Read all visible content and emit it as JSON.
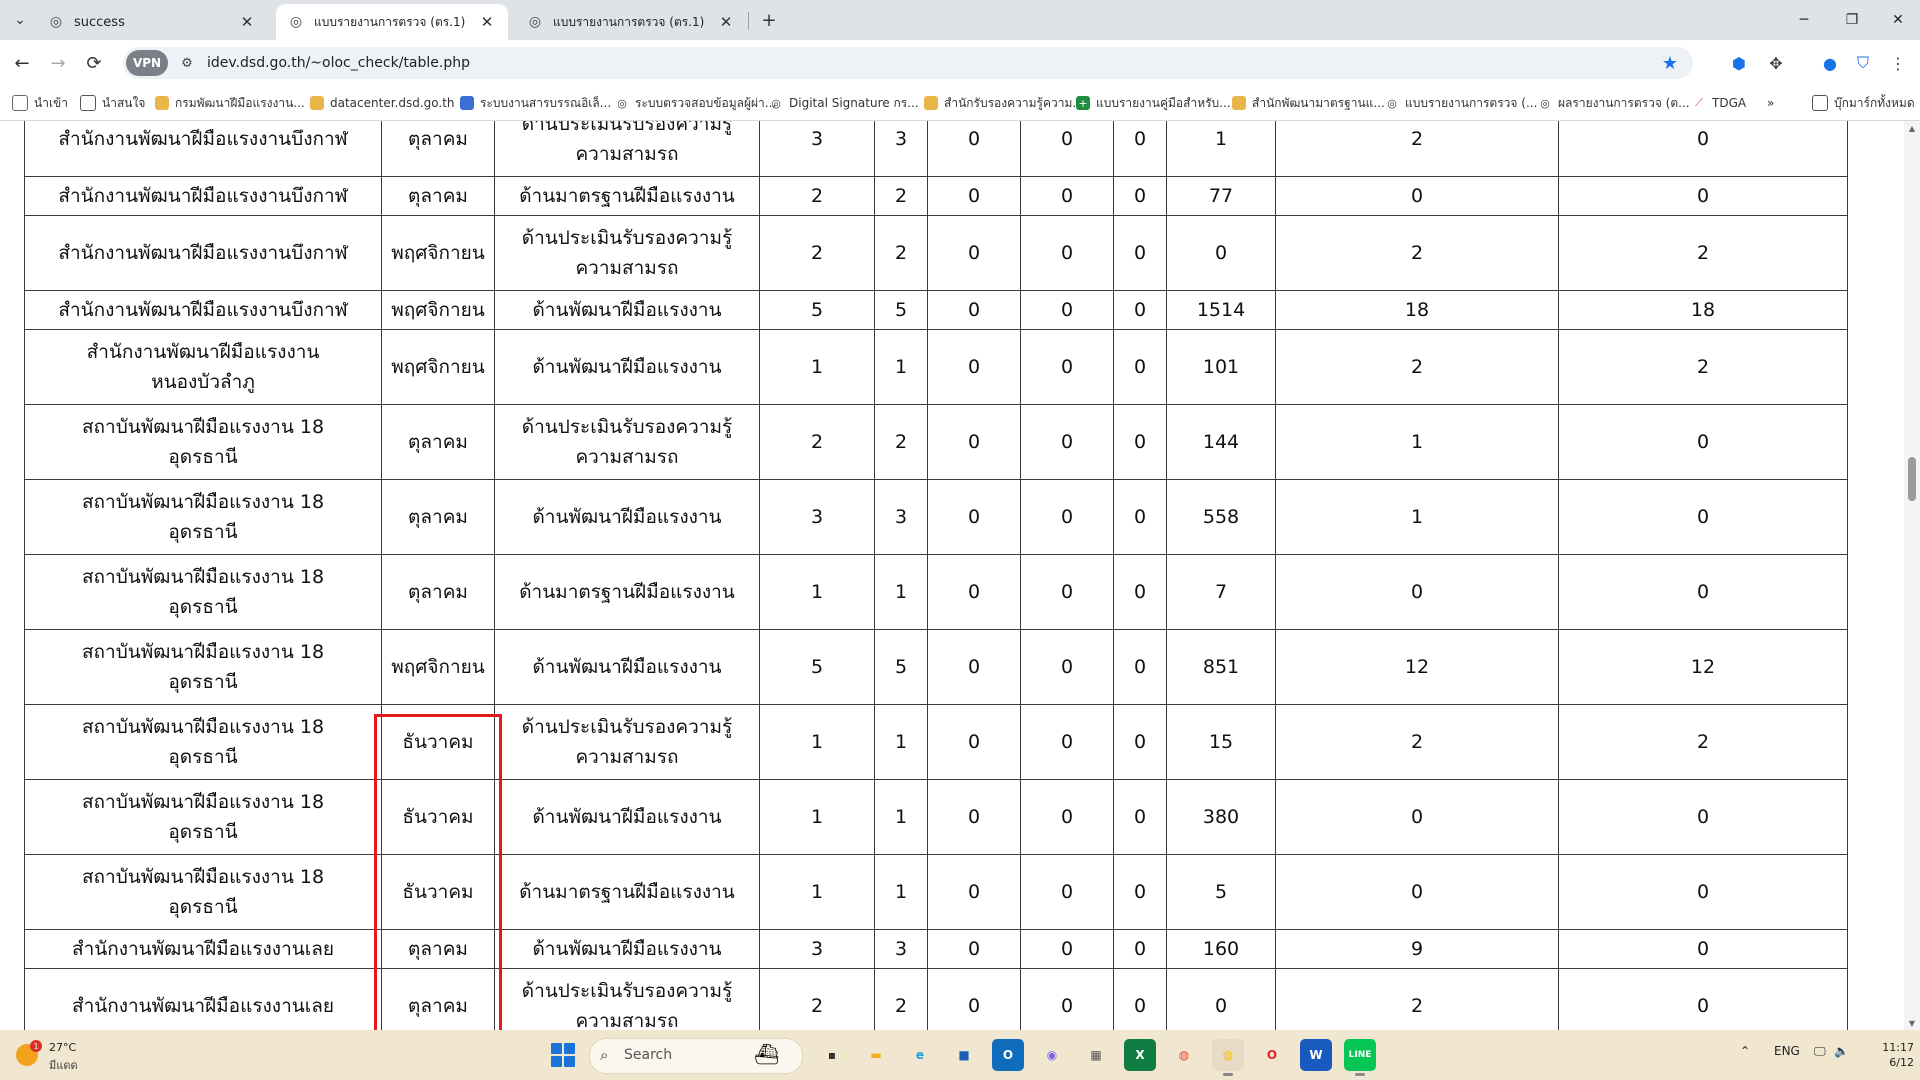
{
  "browser": {
    "tabs": [
      {
        "title": "success",
        "active": false
      },
      {
        "title": "แบบรายงานการตรวจ (ตร.1)",
        "active": true
      },
      {
        "title": "แบบรายงานการตรวจ (ตร.1)",
        "active": false
      }
    ],
    "vpn_label": "VPN",
    "url": "idev.dsd.go.th/~oloc_check/table.php"
  },
  "bookmarks": [
    {
      "label": "นำเข้า",
      "icon": "file-icon"
    },
    {
      "label": "นำสนใจ",
      "icon": "folder-icon"
    },
    {
      "label": "กรมพัฒนาฝีมือแรงงาน...",
      "icon": "dsd-icon"
    },
    {
      "label": "datacenter.dsd.go.th",
      "icon": "dsd-icon"
    },
    {
      "label": "ระบบงานสารบรรณอิเล็...",
      "icon": "doc-icon"
    },
    {
      "label": "ระบบตรวจสอบข้อมูลผู้ผ่า...",
      "icon": "globe-icon"
    },
    {
      "label": "Digital Signature กร...",
      "icon": "globe-icon"
    },
    {
      "label": "สำนักรับรองความรู้ความ...",
      "icon": "dsd-icon"
    },
    {
      "label": "แบบรายงานคู่มือสำหรับ...",
      "icon": "sheet-icon"
    },
    {
      "label": "สำนักพัฒนามาตรฐานแ...",
      "icon": "dsd-icon"
    },
    {
      "label": "แบบรายงานการตรวจ (...",
      "icon": "globe-icon"
    },
    {
      "label": "ผลรายงานการตรวจ (ต...",
      "icon": "globe-icon"
    },
    {
      "label": "TDGA",
      "icon": "tdga-icon"
    },
    {
      "label": "บุ๊กมาร์กทั้งหมด",
      "icon": "folder-icon"
    }
  ],
  "table": {
    "rows": [
      {
        "unit": [
          "สำนักงานพัฒนาฝีมือแรงงานบึงกาฬ"
        ],
        "month": "ตุลาคม",
        "category": [
          "ด้านประเมินรับรองความรู้",
          "ความสามรถ"
        ],
        "values": [
          "3",
          "3",
          "0",
          "0",
          "0",
          "1",
          "2",
          "0"
        ]
      },
      {
        "unit": [
          "สำนักงานพัฒนาฝีมือแรงงานบึงกาฬ"
        ],
        "month": "ตุลาคม",
        "category": [
          "ด้านมาตรฐานฝีมือแรงงาน"
        ],
        "values": [
          "2",
          "2",
          "0",
          "0",
          "0",
          "77",
          "0",
          "0"
        ]
      },
      {
        "unit": [
          "สำนักงานพัฒนาฝีมือแรงงานบึงกาฬ"
        ],
        "month": "พฤศจิกายน",
        "category": [
          "ด้านประเมินรับรองความรู้",
          "ความสามรถ"
        ],
        "values": [
          "2",
          "2",
          "0",
          "0",
          "0",
          "0",
          "2",
          "2"
        ]
      },
      {
        "unit": [
          "สำนักงานพัฒนาฝีมือแรงงานบึงกาฬ"
        ],
        "month": "พฤศจิกายน",
        "category": [
          "ด้านพัฒนาฝีมือแรงงาน"
        ],
        "values": [
          "5",
          "5",
          "0",
          "0",
          "0",
          "1514",
          "18",
          "18"
        ]
      },
      {
        "unit": [
          "สำนักงานพัฒนาฝีมือแรงงาน",
          "หนองบัวลำภู"
        ],
        "month": "พฤศจิกายน",
        "category": [
          "ด้านพัฒนาฝีมือแรงงาน"
        ],
        "values": [
          "1",
          "1",
          "0",
          "0",
          "0",
          "101",
          "2",
          "2"
        ]
      },
      {
        "unit": [
          "สถาบันพัฒนาฝีมือแรงงาน 18",
          "อุดรธานี"
        ],
        "month": "ตุลาคม",
        "category": [
          "ด้านประเมินรับรองความรู้",
          "ความสามรถ"
        ],
        "values": [
          "2",
          "2",
          "0",
          "0",
          "0",
          "144",
          "1",
          "0"
        ]
      },
      {
        "unit": [
          "สถาบันพัฒนาฝีมือแรงงาน 18",
          "อุดรธานี"
        ],
        "month": "ตุลาคม",
        "category": [
          "ด้านพัฒนาฝีมือแรงงาน"
        ],
        "values": [
          "3",
          "3",
          "0",
          "0",
          "0",
          "558",
          "1",
          "0"
        ]
      },
      {
        "unit": [
          "สถาบันพัฒนาฝีมือแรงงาน 18",
          "อุดรธานี"
        ],
        "month": "ตุลาคม",
        "category": [
          "ด้านมาตรฐานฝีมือแรงงาน"
        ],
        "values": [
          "1",
          "1",
          "0",
          "0",
          "0",
          "7",
          "0",
          "0"
        ]
      },
      {
        "unit": [
          "สถาบันพัฒนาฝีมือแรงงาน 18",
          "อุดรธานี"
        ],
        "month": "พฤศจิกายน",
        "category": [
          "ด้านพัฒนาฝีมือแรงงาน"
        ],
        "values": [
          "5",
          "5",
          "0",
          "0",
          "0",
          "851",
          "12",
          "12"
        ]
      },
      {
        "unit": [
          "สถาบันพัฒนาฝีมือแรงงาน 18",
          "อุดรธานี"
        ],
        "month": "ธันวาคม",
        "category": [
          "ด้านประเมินรับรองความรู้",
          "ความสามรถ"
        ],
        "values": [
          "1",
          "1",
          "0",
          "0",
          "0",
          "15",
          "2",
          "2"
        ]
      },
      {
        "unit": [
          "สถาบันพัฒนาฝีมือแรงงาน 18",
          "อุดรธานี"
        ],
        "month": "ธันวาคม",
        "category": [
          "ด้านพัฒนาฝีมือแรงงาน"
        ],
        "values": [
          "1",
          "1",
          "0",
          "0",
          "0",
          "380",
          "0",
          "0"
        ]
      },
      {
        "unit": [
          "สถาบันพัฒนาฝีมือแรงงาน 18",
          "อุดรธานี"
        ],
        "month": "ธันวาคม",
        "category": [
          "ด้านมาตรฐานฝีมือแรงงาน"
        ],
        "values": [
          "1",
          "1",
          "0",
          "0",
          "0",
          "5",
          "0",
          "0"
        ]
      },
      {
        "unit": [
          "สำนักงานพัฒนาฝีมือแรงงานเลย"
        ],
        "month": "ตุลาคม",
        "category": [
          "ด้านพัฒนาฝีมือแรงงาน"
        ],
        "values": [
          "3",
          "3",
          "0",
          "0",
          "0",
          "160",
          "9",
          "0"
        ]
      },
      {
        "unit": [
          "สำนักงานพัฒนาฝีมือแรงงานเลย"
        ],
        "month": "ตุลาคม",
        "category": [
          "ด้านประเมินรับรองความรู้",
          "ความสามรถ"
        ],
        "values": [
          "2",
          "2",
          "0",
          "0",
          "0",
          "0",
          "2",
          "0"
        ]
      }
    ]
  },
  "taskbar": {
    "weather_temp": "27°C",
    "weather_condition": "มีแดด",
    "weather_badge": "1",
    "search_placeholder": "Search",
    "apps": [
      {
        "name": "file-explorer-dark",
        "glyph": "▪",
        "color": "#333333",
        "bg": "#f1e6cf"
      },
      {
        "name": "file-explorer",
        "glyph": "▬",
        "color": "#f2b01e",
        "bg": "#f1e6cf"
      },
      {
        "name": "edge",
        "glyph": "e",
        "color": "#1ba1e2",
        "bg": "#f1e6cf"
      },
      {
        "name": "store",
        "glyph": "■",
        "color": "#1a5fb4",
        "bg": "#f1e6cf"
      },
      {
        "name": "outlook",
        "glyph": "O",
        "color": "#ffffff",
        "bg": "#0f6cbd"
      },
      {
        "name": "copilot",
        "glyph": "◉",
        "color": "#7a5cf0",
        "bg": "#f1e6cf"
      },
      {
        "name": "calculator",
        "glyph": "▦",
        "color": "#555555",
        "bg": "#f1e6cf"
      },
      {
        "name": "excel",
        "glyph": "X",
        "color": "#ffffff",
        "bg": "#107c41"
      },
      {
        "name": "chrome",
        "glyph": "◍",
        "color": "#ea4335",
        "bg": "#f1e6cf"
      },
      {
        "name": "chrome-active",
        "glyph": "◍",
        "color": "#fbbc04",
        "bg": "#e6dcc6"
      },
      {
        "name": "opera",
        "glyph": "O",
        "color": "#e0242b",
        "bg": "#f1e6cf"
      },
      {
        "name": "word",
        "glyph": "W",
        "color": "#ffffff",
        "bg": "#185abd"
      },
      {
        "name": "line",
        "glyph": "LINE",
        "color": "#ffffff",
        "bg": "#06c755"
      }
    ],
    "lang": "ENG",
    "time": "11:17",
    "date": "6/12"
  },
  "colors": {
    "highlight": "#e21a1a",
    "taskbar": "#f1e6cf",
    "accent": "#1a73e8"
  }
}
